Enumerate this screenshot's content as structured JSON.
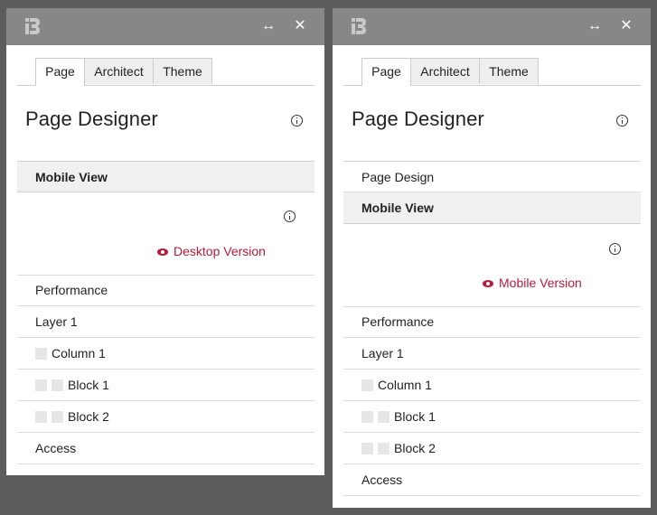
{
  "left": {
    "logo": "B",
    "tabs": [
      "Page",
      "Architect",
      "Theme"
    ],
    "title": "Page Designer",
    "section_header": "Mobile View",
    "version_link": "Desktop Version",
    "rows": [
      "Performance",
      "Layer 1",
      "Column 1",
      "Block 1",
      "Block 2",
      "Access"
    ]
  },
  "right": {
    "logo": "B",
    "tabs": [
      "Page",
      "Architect",
      "Theme"
    ],
    "title": "Page Designer",
    "page_design": "Page Design",
    "section_header": "Mobile View",
    "version_link": "Mobile Version",
    "rows": [
      "Performance",
      "Layer 1",
      "Column 1",
      "Block 1",
      "Block 2",
      "Access"
    ]
  },
  "icons": {
    "expand": "↔",
    "close": "✕"
  },
  "colors": {
    "titlebar": "#878787",
    "accent": "#b71c39",
    "background": "#5c5c5c"
  }
}
